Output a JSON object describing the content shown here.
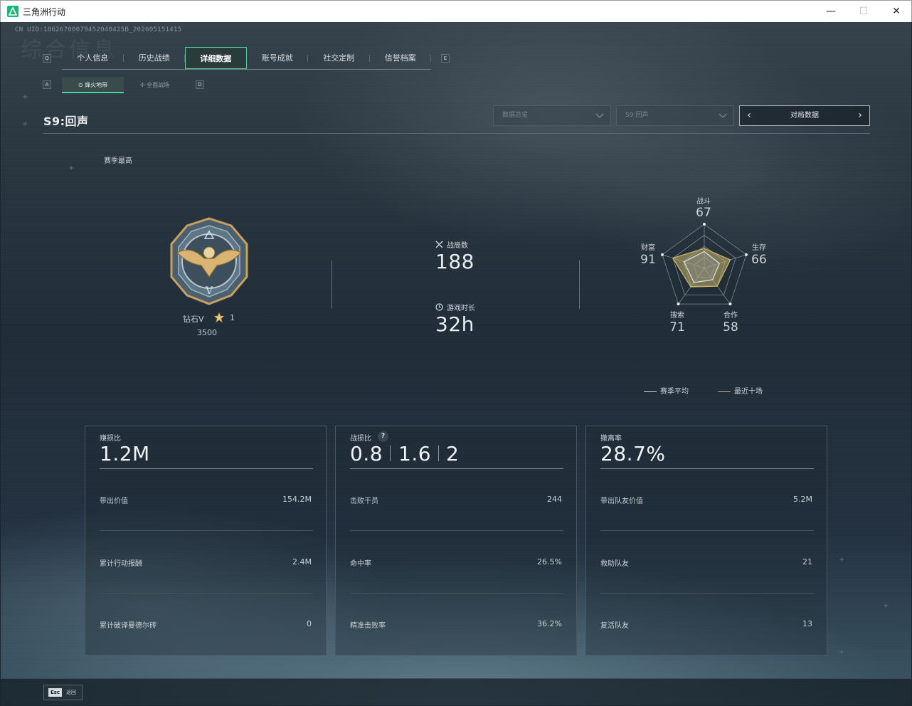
{
  "window": {
    "title": "三角洲行动",
    "controls": {
      "minimize": "—",
      "maximize": "☐",
      "close": "✕"
    }
  },
  "uid": "CN UID:18626700079452040425B_202605151415",
  "background_text": "综合信息",
  "key_hints": {
    "tabs_left": "Q",
    "tabs_right": "E",
    "sub_left": "A",
    "sub_right": "D"
  },
  "tabs": [
    {
      "label": "个人信息",
      "active": false
    },
    {
      "label": "历史战绩",
      "active": false
    },
    {
      "label": "详细数据",
      "active": true
    },
    {
      "label": "账号成就",
      "active": false
    },
    {
      "label": "社交定制",
      "active": false
    },
    {
      "label": "信誉档案",
      "active": false
    }
  ],
  "subtabs": [
    {
      "label": "烽火地带",
      "icon": "radar-icon",
      "active": true
    },
    {
      "label": "全面战场",
      "icon": "target-icon",
      "active": false
    }
  ],
  "season_title": "S9:回声",
  "selects": {
    "overview": "数据总览",
    "season": "S9:回声",
    "match_data": "对局数据"
  },
  "season_best_label": "赛季最高",
  "rank": {
    "name": "钻石V",
    "stars": "1",
    "score": "3500",
    "emblem_letter": "V"
  },
  "stats": {
    "matches_label": "战局数",
    "matches_value": "188",
    "playtime_label": "游戏时长",
    "playtime_value": "32h"
  },
  "radar": {
    "axes": [
      {
        "label": "战斗",
        "value": "67"
      },
      {
        "label": "生存",
        "value": "66"
      },
      {
        "label": "合作",
        "value": "58"
      },
      {
        "label": "搜索",
        "value": "71"
      },
      {
        "label": "财富",
        "value": "91"
      }
    ],
    "season_avg": [
      0.38,
      0.36,
      0.32,
      0.4,
      0.48
    ],
    "recent_ten": [
      0.45,
      0.62,
      0.5,
      0.52,
      0.75
    ],
    "legend": {
      "season_avg": "赛季平均",
      "recent_ten": "最近十场"
    },
    "colors": {
      "season_avg": "#d7dcdf",
      "recent_ten": "#c9b36a"
    }
  },
  "cards": [
    {
      "title": "赚损比",
      "big": "1.2M",
      "rows": [
        {
          "label": "带出价值",
          "value": "154.2M"
        },
        {
          "label": "累计行动报酬",
          "value": "2.4M"
        },
        {
          "label": "累计破译曼德尔砖",
          "value": "0"
        }
      ]
    },
    {
      "title": "战损比",
      "big_parts": [
        "0.8",
        "1.6",
        "2"
      ],
      "help": "?",
      "rows": [
        {
          "label": "击败干员",
          "value": "244"
        },
        {
          "label": "命中率",
          "value": "26.5%"
        },
        {
          "label": "精准击败率",
          "value": "36.2%"
        }
      ]
    },
    {
      "title": "撤离率",
      "big": "28.7%",
      "rows": [
        {
          "label": "带出队友价值",
          "value": "5.2M"
        },
        {
          "label": "救助队友",
          "value": "21"
        },
        {
          "label": "复活队友",
          "value": "13"
        }
      ]
    }
  ],
  "footer": {
    "esc_key": "Esc",
    "esc_label": "返回"
  },
  "colors": {
    "accent": "#4fd1a0",
    "gold": "#c9b36a"
  }
}
